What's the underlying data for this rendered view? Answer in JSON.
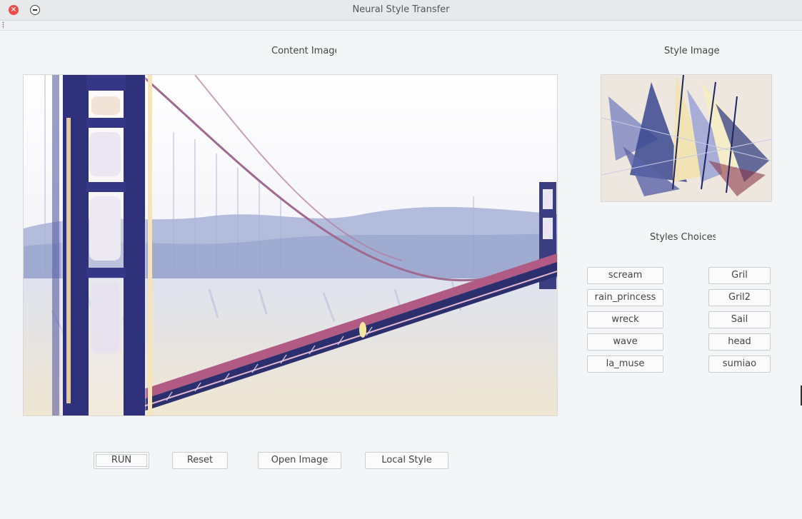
{
  "window": {
    "title": "Neural Style Transfer"
  },
  "labels": {
    "content_image": "Content Image",
    "style_image": "Style Image",
    "styles_choices": "Styles Choices"
  },
  "style_choices": {
    "left": [
      "scream",
      "rain_princess",
      "wreck",
      "wave",
      "la_muse"
    ],
    "right": [
      "Gril",
      "Gril2",
      "Sail",
      "head",
      "sumiao"
    ]
  },
  "actions": {
    "run": "RUN",
    "reset": "Reset",
    "open_image": "Open Image",
    "local_style": "Local Style"
  },
  "colors": {
    "close_button": "#ee4b4b",
    "background": "#f4f5f7",
    "bridge_navy": "#2c2f6e",
    "cable_mauve": "#a06a90"
  }
}
